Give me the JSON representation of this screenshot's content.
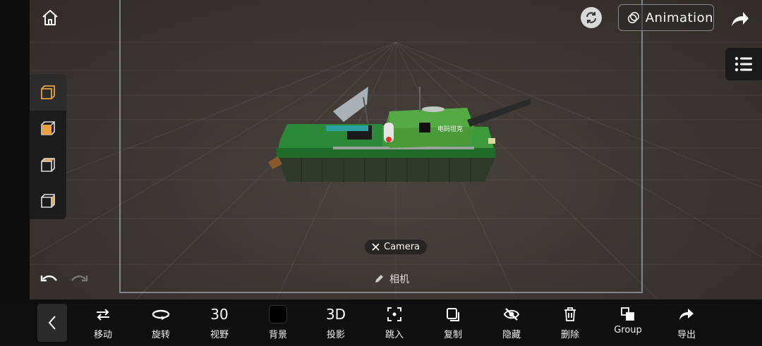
{
  "header": {
    "animation_label": "Animation"
  },
  "viewport": {
    "camera_chip": "Camera",
    "camera_label": "相机",
    "tank_text": "电码坦克"
  },
  "toolbar": {
    "move": "移动",
    "rotate": "旋转",
    "fov_value": "30",
    "fov": "视野",
    "background": "背景",
    "projection_value": "3D",
    "projection": "投影",
    "jump_in": "跳入",
    "copy": "复制",
    "hide": "隐藏",
    "delete": "删除",
    "group": "Group",
    "export": "导出"
  },
  "colors": {
    "accent": "#e8a040",
    "tank_green": "#3a9a3a",
    "tank_dark": "#244a24",
    "viewport_bg": "#3d3833"
  },
  "icons": [
    "home-icon",
    "refresh-icon",
    "animation-icon",
    "share-icon",
    "list-icon",
    "cube-view-icon",
    "undo-icon",
    "redo-icon",
    "pencil-icon",
    "close-icon",
    "back-icon",
    "move-icon",
    "rotate-icon",
    "color-swatch-icon",
    "jump-in-icon",
    "copy-icon",
    "hide-icon",
    "trash-icon",
    "group-icon",
    "export-icon"
  ]
}
